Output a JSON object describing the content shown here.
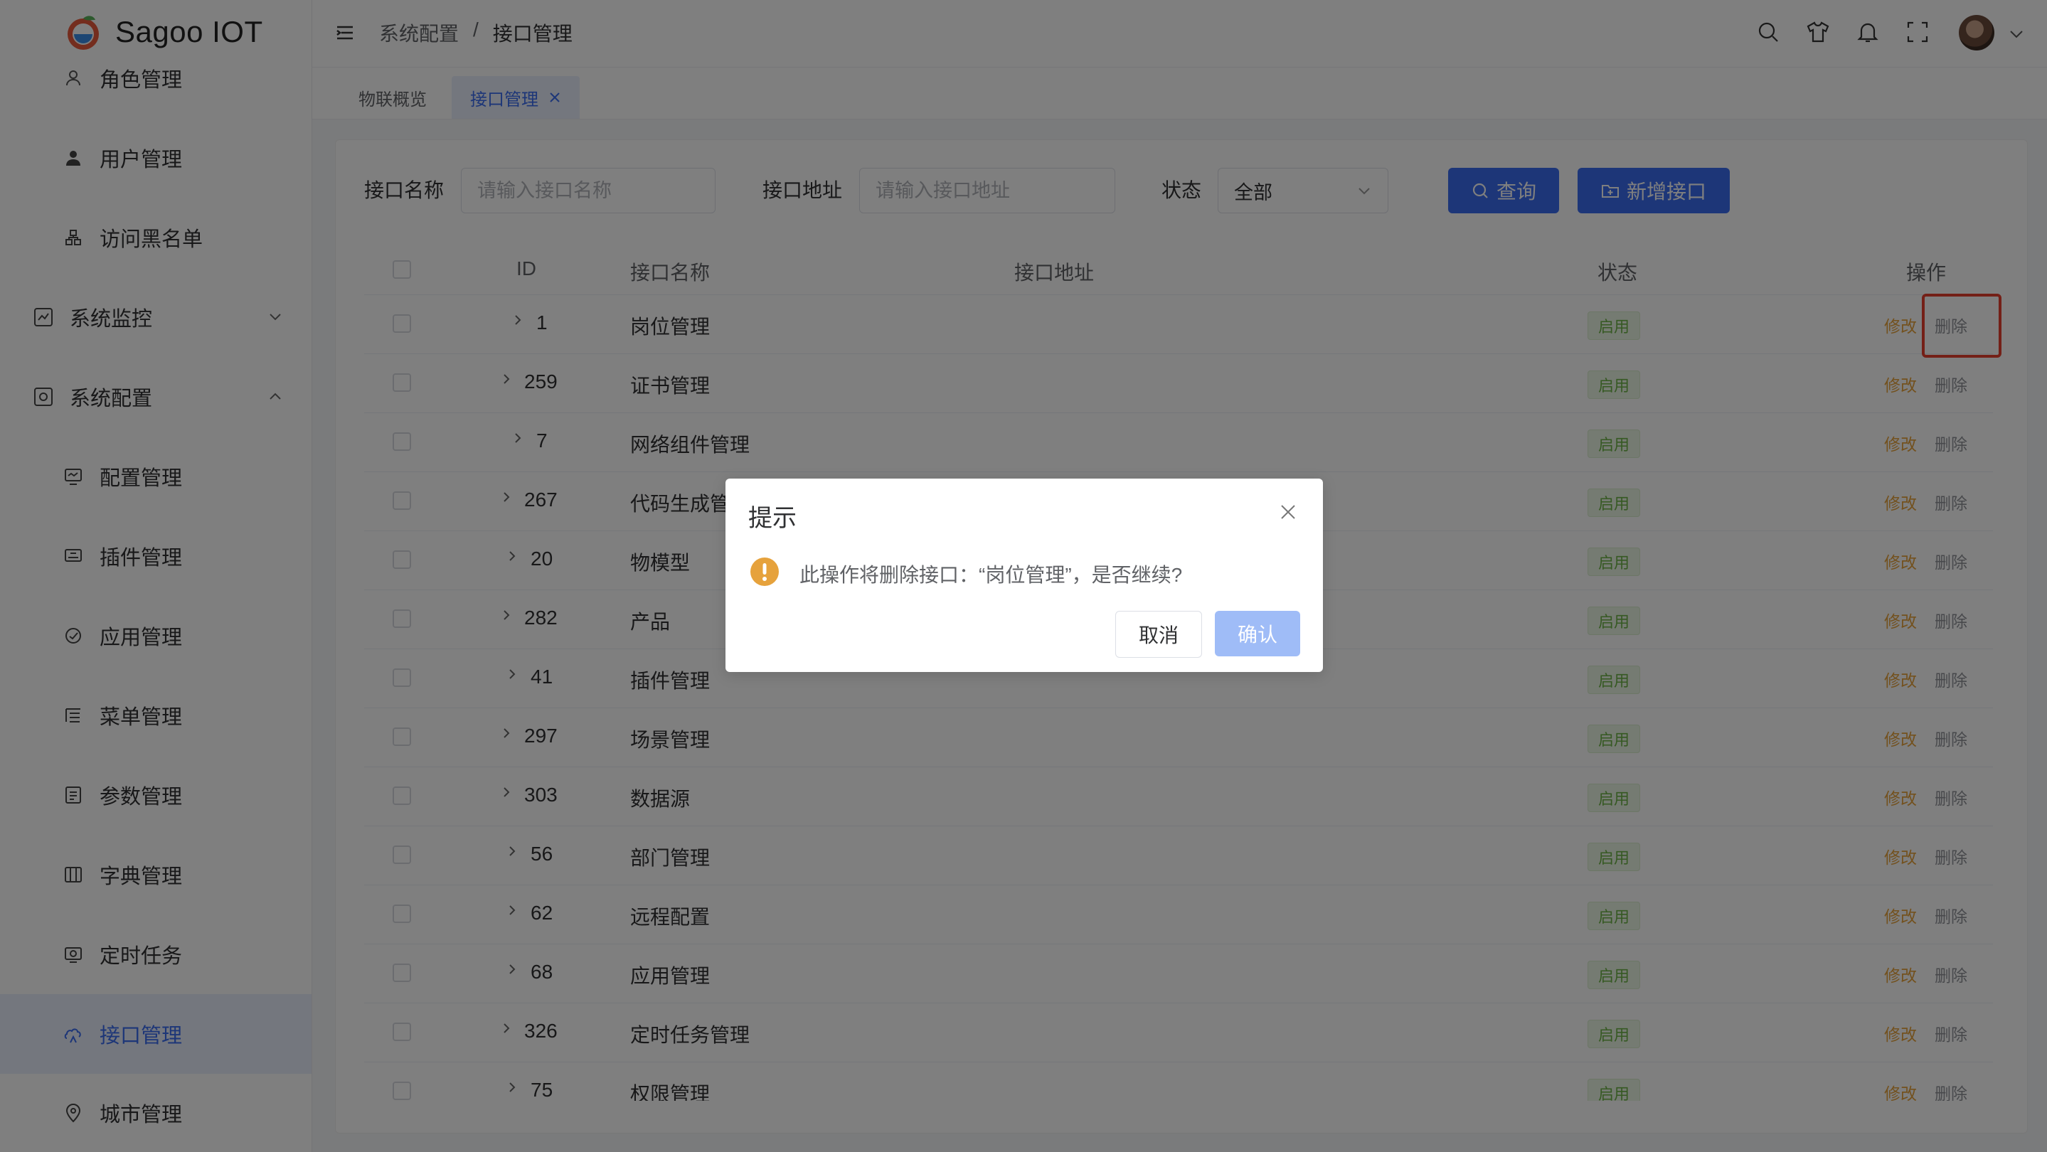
{
  "app": {
    "name": "Sagoo IOT"
  },
  "sidebar": {
    "items": [
      {
        "label": "角色管理",
        "icon": "role-icon"
      },
      {
        "label": "用户管理",
        "icon": "user-icon"
      },
      {
        "label": "访问黑名单",
        "icon": "blacklist-icon"
      },
      {
        "label": "系统监控",
        "icon": "monitor-icon"
      },
      {
        "label": "系统配置",
        "icon": "settings-icon"
      },
      {
        "label": "配置管理",
        "icon": "config-icon"
      },
      {
        "label": "插件管理",
        "icon": "plugin-icon"
      },
      {
        "label": "应用管理",
        "icon": "app-icon"
      },
      {
        "label": "菜单管理",
        "icon": "menu-icon"
      },
      {
        "label": "参数管理",
        "icon": "params-icon"
      },
      {
        "label": "字典管理",
        "icon": "dict-icon"
      },
      {
        "label": "定时任务",
        "icon": "timer-icon"
      },
      {
        "label": "接口管理",
        "icon": "api-icon"
      },
      {
        "label": "城市管理",
        "icon": "city-icon"
      }
    ]
  },
  "header": {
    "breadcrumb": [
      "系统配置",
      "/",
      "接口管理"
    ]
  },
  "tabs": [
    {
      "label": "物联概览"
    },
    {
      "label": "接口管理"
    }
  ],
  "filters": {
    "name_label": "接口名称",
    "name_placeholder": "请输入接口名称",
    "address_label": "接口地址",
    "address_placeholder": "请输入接口地址",
    "status_label": "状态",
    "status_value": "全部",
    "query_button": "查询",
    "add_button": "新增接口"
  },
  "table": {
    "headers": {
      "id": "ID",
      "name": "接口名称",
      "address": "接口地址",
      "status": "状态",
      "actions": "操作"
    },
    "edit_label": "修改",
    "delete_label": "删除",
    "rows": [
      {
        "id": "1",
        "name": "岗位管理",
        "status": "启用"
      },
      {
        "id": "259",
        "name": "证书管理",
        "status": "启用"
      },
      {
        "id": "7",
        "name": "网络组件管理",
        "status": "启用"
      },
      {
        "id": "267",
        "name": "代码生成管",
        "status": "启用"
      },
      {
        "id": "20",
        "name": "物模型",
        "status": "启用"
      },
      {
        "id": "282",
        "name": "产品",
        "status": "启用"
      },
      {
        "id": "41",
        "name": "插件管理",
        "status": "启用"
      },
      {
        "id": "297",
        "name": "场景管理",
        "status": "启用"
      },
      {
        "id": "303",
        "name": "数据源",
        "status": "启用"
      },
      {
        "id": "56",
        "name": "部门管理",
        "status": "启用"
      },
      {
        "id": "62",
        "name": "远程配置",
        "status": "启用"
      },
      {
        "id": "68",
        "name": "应用管理",
        "status": "启用"
      },
      {
        "id": "326",
        "name": "定时任务管理",
        "status": "启用"
      },
      {
        "id": "75",
        "name": "权限管理",
        "status": "启用"
      }
    ]
  },
  "dialog": {
    "title": "提示",
    "message": "此操作将删除接口：“岗位管理”，是否继续?",
    "cancel": "取消",
    "confirm": "确认"
  },
  "colors": {
    "accent": "#3a6df0",
    "success": "#6cb346",
    "warning": "#e6a23c",
    "highlight": "#e8402f"
  }
}
